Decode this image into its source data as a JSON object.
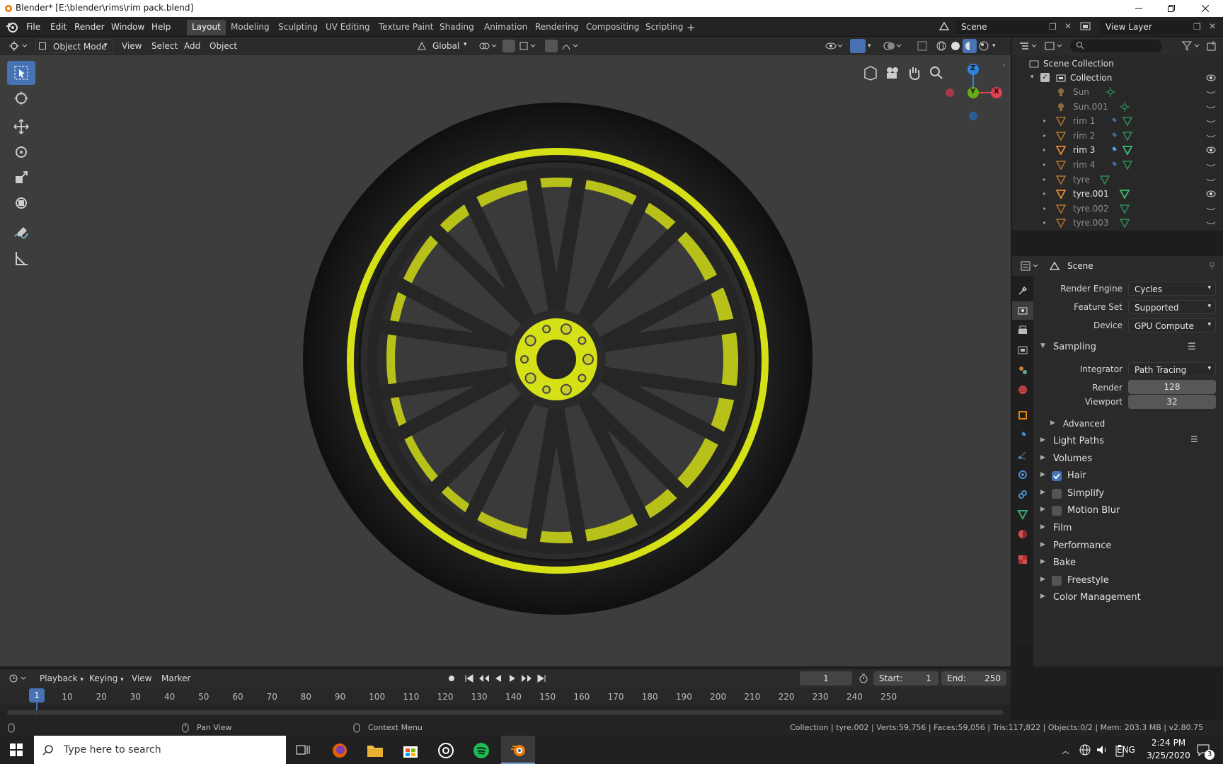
{
  "window": {
    "title": "Blender* [E:\\blender\\rims\\rim pack.blend]"
  },
  "menus": [
    "File",
    "Edit",
    "Render",
    "Window",
    "Help"
  ],
  "workspaces": [
    "Layout",
    "Modeling",
    "Sculpting",
    "UV Editing",
    "Texture Paint",
    "Shading",
    "Animation",
    "Rendering",
    "Compositing",
    "Scripting"
  ],
  "scene": {
    "name": "Scene",
    "view_layer": "View Layer"
  },
  "viewport_header": {
    "mode": "Object Mode",
    "view": "View",
    "select": "Select",
    "add": "Add",
    "object": "Object",
    "transform": "Global"
  },
  "gizmo": {
    "z": "Z",
    "y": "Y",
    "x": "X"
  },
  "outliner": {
    "root": "Scene Collection",
    "collection": "Collection",
    "items": [
      {
        "name": "Sun",
        "dim": true
      },
      {
        "name": "Sun.001",
        "dim": true
      },
      {
        "name": "rim 1",
        "dim": true
      },
      {
        "name": "rim 2",
        "dim": true
      },
      {
        "name": "rim 3",
        "dim": false
      },
      {
        "name": "rim 4",
        "dim": true
      },
      {
        "name": "tyre",
        "dim": true
      },
      {
        "name": "tyre.001",
        "dim": false
      },
      {
        "name": "tyre.002",
        "dim": true
      },
      {
        "name": "tyre.003",
        "dim": true
      }
    ]
  },
  "properties": {
    "context": "Scene",
    "render_engine_label": "Render Engine",
    "render_engine": "Cycles",
    "feature_set_label": "Feature Set",
    "feature_set": "Supported",
    "device_label": "Device",
    "device": "GPU Compute",
    "sampling": "Sampling",
    "integrator_label": "Integrator",
    "integrator": "Path Tracing",
    "render_label": "Render",
    "render_samples": "128",
    "viewport_label": "Viewport",
    "viewport_samples": "32",
    "advanced": "Advanced",
    "sections": [
      {
        "label": "Light Paths",
        "checkbox": null
      },
      {
        "label": "Volumes",
        "checkbox": null
      },
      {
        "label": "Hair",
        "checkbox": true
      },
      {
        "label": "Simplify",
        "checkbox": false
      },
      {
        "label": "Motion Blur",
        "checkbox": false
      },
      {
        "label": "Film",
        "checkbox": null
      },
      {
        "label": "Performance",
        "checkbox": null
      },
      {
        "label": "Bake",
        "checkbox": null
      },
      {
        "label": "Freestyle",
        "checkbox": false
      },
      {
        "label": "Color Management",
        "checkbox": null
      }
    ]
  },
  "timeline": {
    "playback": "Playback",
    "keying": "Keying",
    "view": "View",
    "marker": "Marker",
    "current_frame": "1",
    "start_label": "Start:",
    "start": "1",
    "end_label": "End:",
    "end": "250",
    "ticks": [
      "10",
      "20",
      "30",
      "40",
      "50",
      "60",
      "70",
      "80",
      "90",
      "100",
      "110",
      "120",
      "130",
      "140",
      "150",
      "160",
      "170",
      "180",
      "190",
      "200",
      "210",
      "220",
      "230",
      "240",
      "250"
    ]
  },
  "status": {
    "pan_view": "Pan View",
    "context_menu": "Context Menu",
    "stats": "Collection | tyre.002 | Verts:59,756 | Faces:59,056 | Tris:117,822 | Objects:0/2 | Mem: 203.3 MB | v2.80.75"
  },
  "taskbar": {
    "search_placeholder": "Type here to search",
    "lang": "ENG",
    "time": "2:24 PM",
    "date": "3/25/2020",
    "notifications": "3"
  },
  "colors": {
    "accent": "#4772b3",
    "rim_yellow": "#d6e016",
    "viewport_bg": "#3d3d3d"
  }
}
